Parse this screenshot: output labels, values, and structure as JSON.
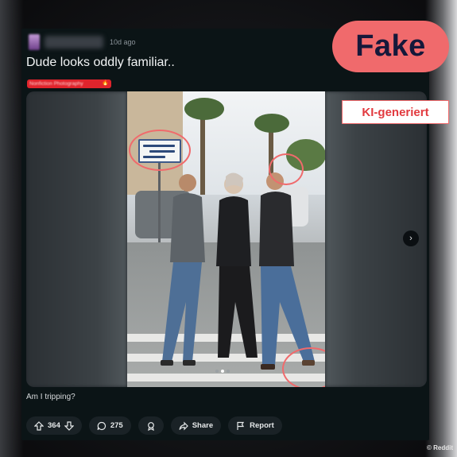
{
  "post": {
    "timestamp": "10d ago",
    "title": "Dude looks oddly familiar..",
    "flair": {
      "text": "Nonfiction Photography",
      "emoji": "🔥"
    },
    "body": "Am I tripping?",
    "actions": {
      "votes": "364",
      "comments": "275",
      "share_label": "Share",
      "report_label": "Report"
    },
    "media": {
      "current_slide": 2,
      "total_slides": 3
    }
  },
  "overlay": {
    "verdict_badge": "Fake",
    "ai_label": "KI-generiert",
    "credit": "© Reddit"
  },
  "colors": {
    "accent_coral": "#f06a6c",
    "badge_text": "#16183a",
    "flair_red": "#e0242c",
    "post_bg": "#0b1416",
    "pill_bg": "#1a2226"
  },
  "icons": [
    "upvote-icon",
    "downvote-icon",
    "comment-icon",
    "award-icon",
    "share-icon",
    "report-flag-icon",
    "chevron-right-icon"
  ]
}
